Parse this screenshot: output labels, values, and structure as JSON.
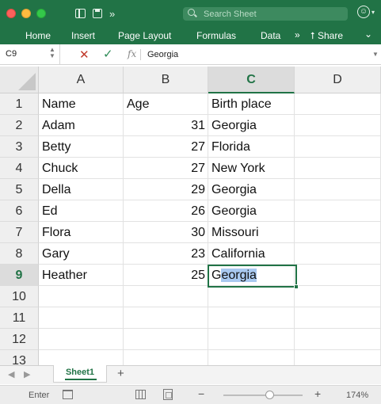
{
  "toolbar": {
    "search_placeholder": "Search Sheet",
    "search_prefix": "Q˅",
    "more_glyph": "»"
  },
  "ribbon": {
    "tabs": [
      "Home",
      "Insert",
      "Page Layout",
      "Formulas",
      "Data"
    ],
    "more_glyph": "»",
    "share_label": "Share",
    "share_icon_glyph": "⭡",
    "chevron_glyph": "⌄"
  },
  "formula_bar": {
    "name_box": "C9",
    "cancel_glyph": "✕",
    "enter_glyph": "✓",
    "fx_label": "fx",
    "formula_value": "Georgia"
  },
  "sheet": {
    "columns": [
      "A",
      "B",
      "C",
      "D"
    ],
    "row_numbers": [
      "1",
      "2",
      "3",
      "4",
      "5",
      "6",
      "7",
      "8",
      "9",
      "10",
      "11",
      "12",
      "13"
    ],
    "selected_cell": {
      "column": "C",
      "row": "9"
    },
    "rows": [
      [
        "Name",
        "Age",
        "Birth place",
        ""
      ],
      [
        "Adam",
        "31",
        "Georgia",
        ""
      ],
      [
        "Betty",
        "27",
        "Florida",
        ""
      ],
      [
        "Chuck",
        "27",
        "New York",
        ""
      ],
      [
        "Della",
        "29",
        "Georgia",
        ""
      ],
      [
        "Ed",
        "26",
        "Georgia",
        ""
      ],
      [
        "Flora",
        "30",
        "Missouri",
        ""
      ],
      [
        "Gary",
        "23",
        "California",
        ""
      ],
      [
        "Heather",
        "25",
        "Georgia",
        ""
      ],
      [
        "",
        "",
        "",
        ""
      ],
      [
        "",
        "",
        "",
        ""
      ],
      [
        "",
        "",
        "",
        ""
      ],
      [
        "",
        "",
        "",
        ""
      ]
    ],
    "edit_split": {
      "before": "G",
      "highlighted": "eorgia"
    }
  },
  "sheet_tabs": {
    "tabs": [
      "Sheet1"
    ],
    "active": "Sheet1",
    "add_glyph": "+",
    "prev_glyph": "◀",
    "next_glyph": "▶"
  },
  "status": {
    "mode": "Enter",
    "zoom_level": "174%",
    "zoom_slider_fraction": 0.59,
    "minus_glyph": "−",
    "plus_glyph": "+"
  },
  "colors": {
    "brand_green": "#217346",
    "selection_highlight": "#a9c9f0"
  }
}
